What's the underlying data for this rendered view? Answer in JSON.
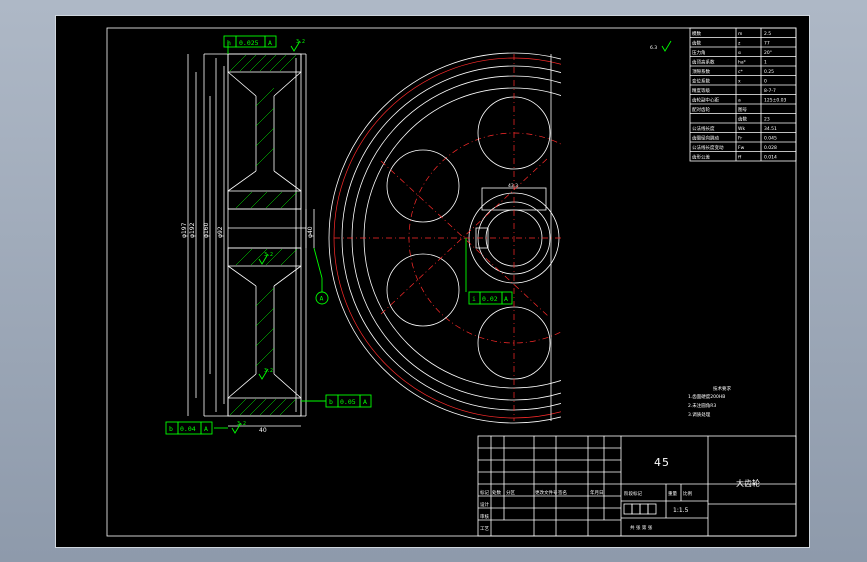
{
  "drawing": {
    "material": "45",
    "part_name": "大齿轮",
    "scale": "1:1.5",
    "tech_requirements_title": "技术要求",
    "tech_requirements": [
      "1.齿面硬度200HB",
      "2.未注圆角R3",
      "3.调质处理"
    ]
  },
  "tolerances": {
    "top_frame_symbol": "h",
    "top_frame_value": "0.025",
    "top_frame_datum": "A",
    "mid_frame_symbol": "i",
    "mid_frame_value": "0.02",
    "mid_frame_datum": "A",
    "right_frame_symbol": "b",
    "right_frame_value": "0.05",
    "right_frame_datum": "A",
    "bottom_frame_symbol": "b",
    "bottom_frame_value": "0.04",
    "bottom_frame_datum": "A",
    "datum_label": "A",
    "roughness_top": "3.2",
    "roughness_mid": "3.2",
    "roughness_bottom": "3.2",
    "roughness_corner": "6.3"
  },
  "param_table": {
    "rows": [
      [
        "模数",
        "m",
        "2.5"
      ],
      [
        "齿数",
        "z",
        "77"
      ],
      [
        "压力角",
        "α",
        "20°"
      ],
      [
        "齿顶高系数",
        "ha*",
        "1"
      ],
      [
        "顶隙系数",
        "c*",
        "0.25"
      ],
      [
        "变位系数",
        "x",
        "0"
      ],
      [
        "精度等级",
        "",
        "8-7-7"
      ],
      [
        "齿轮副中心距",
        "a",
        "125±0.03"
      ],
      [
        "配对齿轮",
        "图号",
        ""
      ],
      [
        "",
        "齿数",
        "23"
      ],
      [
        "公法线长度",
        "Wk",
        "34.51"
      ],
      [
        "齿圈径向跳动",
        "Fr",
        "0.045"
      ],
      [
        "公法线长度变动",
        "Fw",
        "0.028"
      ],
      [
        "齿形公差",
        "ff",
        "0.014"
      ]
    ]
  },
  "dimensions": {
    "d1": "φ197",
    "d2": "φ192",
    "d3": "φ160",
    "d4": "φ92",
    "bore": "φ40",
    "keyway": "43.3",
    "width": "40"
  },
  "title_block": {
    "row_labels": [
      "标记",
      "设计",
      "审核",
      "工艺"
    ],
    "col_labels": [
      "处数",
      "分区",
      "更改文件号",
      "签名",
      "年月日"
    ],
    "stage_label": "阶段标记",
    "weight_label": "重量",
    "scale_label": "比例",
    "sheet_label": "共 张 第 张"
  }
}
